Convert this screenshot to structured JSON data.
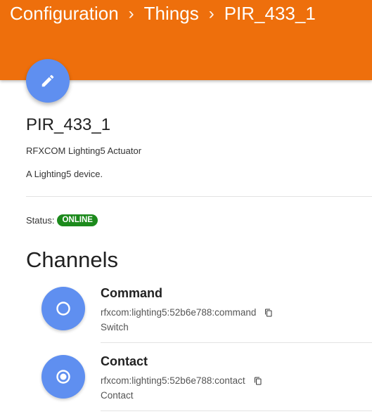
{
  "header": {
    "breadcrumb": [
      "Configuration",
      "Things",
      "PIR_433_1"
    ],
    "separator": "›",
    "color": "#ee6f0c"
  },
  "fab": {
    "icon": "pencil-icon",
    "color": "#5f8ff0"
  },
  "thing": {
    "name": "PIR_433_1",
    "type": "RFXCOM Lighting5 Actuator",
    "description": "A Lighting5 device."
  },
  "status": {
    "label": "Status:",
    "value": "ONLINE",
    "color": "#1c8a1c"
  },
  "channels": {
    "title": "Channels",
    "items": [
      {
        "name": "Command",
        "uid": "rfxcom:lighting5:52b6e788:command",
        "type": "Switch",
        "icon": "circle-outline-icon"
      },
      {
        "name": "Contact",
        "uid": "rfxcom:lighting5:52b6e788:contact",
        "type": "Contact",
        "icon": "radio-dot-icon"
      }
    ]
  }
}
